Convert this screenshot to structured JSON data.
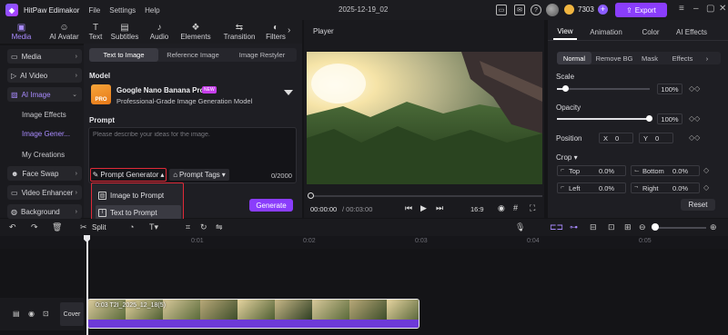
{
  "app": {
    "name": "HitPaw Edimakor",
    "menu": [
      "File",
      "Settings",
      "Help"
    ],
    "project_title": "2025-12-19_02",
    "credits": "7303",
    "export_label": "Export"
  },
  "toolbar": {
    "tools": [
      {
        "label": "Media",
        "icon": "media-icon",
        "active": true
      },
      {
        "label": "AI Avatar",
        "icon": "avatar-icon"
      },
      {
        "label": "Text",
        "icon": "text-icon"
      },
      {
        "label": "Subtitles",
        "icon": "subtitles-icon"
      },
      {
        "label": "Audio",
        "icon": "audio-icon"
      },
      {
        "label": "Elements",
        "icon": "elements-icon"
      },
      {
        "label": "Transition",
        "icon": "transition-icon"
      },
      {
        "label": "Filters",
        "icon": "filters-icon"
      }
    ]
  },
  "sidebar": {
    "media": "Media",
    "ai_video": "AI Video",
    "ai_image": "AI Image",
    "subitems": [
      "Image Effects",
      "Image Gener...",
      "My Creations"
    ],
    "face_swap": "Face Swap",
    "video_enhancer": "Video Enhancer",
    "background": "Background"
  },
  "panel": {
    "tabs": [
      "Text to Image",
      "Reference Image",
      "Image Restyler"
    ],
    "model_heading": "Model",
    "model_name": "Google Nano Banana Pro",
    "model_badge": "NEW",
    "model_thumb_text": "PRO",
    "model_desc": "Professional-Grade Image Generation Model",
    "prompt_heading": "Prompt",
    "prompt_placeholder": "Please describe your ideas for the image.",
    "prompt_generator": "Prompt Generator",
    "prompt_tags": "Prompt Tags",
    "char_count": "0/2000",
    "dropdown": [
      "Image to Prompt",
      "Text to Prompt"
    ],
    "generate": "Generate"
  },
  "player": {
    "title": "Player",
    "time_current": "00:00:00",
    "time_total": "/ 00:03:00",
    "ratio": "16:9"
  },
  "right": {
    "tabs": [
      "View",
      "Animation",
      "Color",
      "AI Effects"
    ],
    "subtabs": [
      "Normal",
      "Remove BG",
      "Mask",
      "Effects"
    ],
    "scale_label": "Scale",
    "scale_value": "100%",
    "scale_level": 0.1,
    "opacity_label": "Opacity",
    "opacity_value": "100%",
    "opacity_level": 1.0,
    "position_label": "Position",
    "pos_x_label": "X",
    "pos_x": "0",
    "pos_y_label": "Y",
    "pos_y": "0",
    "crop_label": "Crop",
    "crop": [
      {
        "label": "Top",
        "value": "0.0%"
      },
      {
        "label": "Bottom",
        "value": "0.0%"
      },
      {
        "label": "Left",
        "value": "0.0%"
      },
      {
        "label": "Right",
        "value": "0.0%"
      }
    ],
    "reset": "Reset"
  },
  "timeline": {
    "split_label": "Split",
    "ticks": [
      "0:01",
      "0:02",
      "0:03",
      "0:04",
      "0:05"
    ],
    "cover_label": "Cover",
    "clip_label": "0:03  T2I_2025_12_18(5)"
  }
}
